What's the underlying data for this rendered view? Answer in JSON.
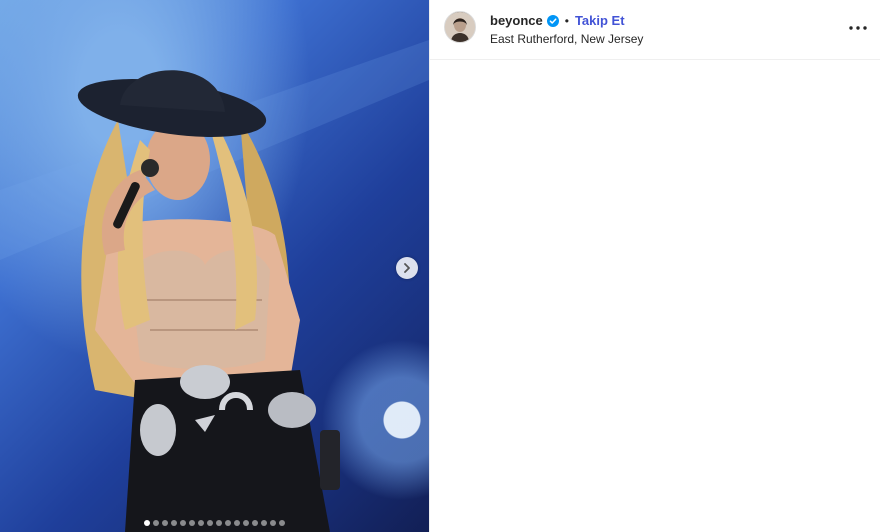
{
  "post": {
    "media": {
      "alt_subject": "performer photo",
      "slide_count": 16,
      "active_slide": 1
    },
    "author": {
      "username": "beyonce",
      "verified": true,
      "follow_label": "Takip Et",
      "bullet": "•",
      "location": "East Rutherford, New Jersey"
    },
    "icons": {
      "next": "chevron-right-icon",
      "more": "more-options-icon",
      "verified": "verified-badge-icon"
    },
    "colors": {
      "follow": "#4253d6",
      "verified": "#0095f6"
    }
  }
}
